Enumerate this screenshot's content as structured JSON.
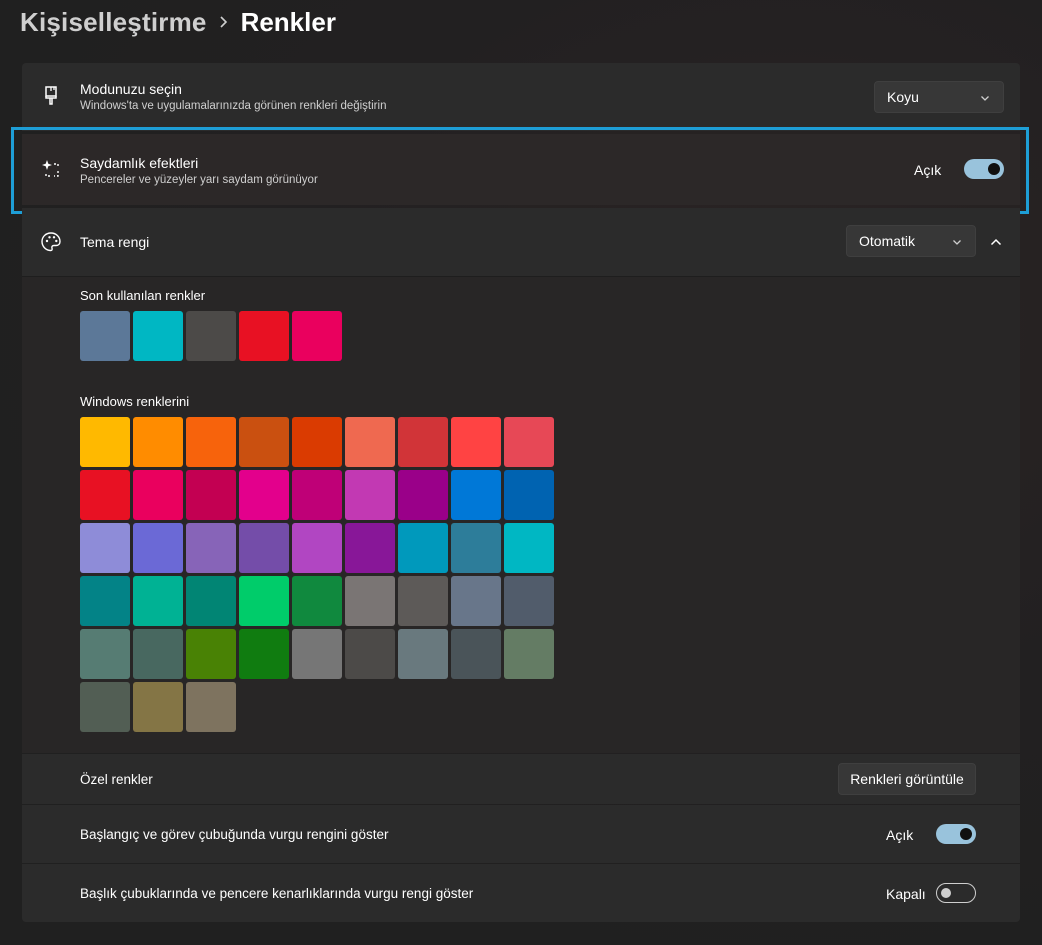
{
  "breadcrumb": {
    "parent": "Kişiselleştirme",
    "current": "Renkler"
  },
  "mode": {
    "title": "Modunuzu seçin",
    "subtitle": "Windows'ta ve uygulamalarınızda görünen renkleri değiştirin",
    "selected": "Koyu",
    "icon": "paint-brush-icon"
  },
  "transparency": {
    "title": "Saydamlık efektleri",
    "subtitle": "Pencereler ve yüzeyler yarı saydam görünüyor",
    "state_label": "Açık",
    "on": true,
    "icon": "sparkle-selection-icon"
  },
  "accent": {
    "title": "Tema rengi",
    "selected": "Otomatik",
    "icon": "palette-icon",
    "expanded": true
  },
  "recent_colors": {
    "label": "Son kullanılan renkler",
    "colors": [
      "#5c7898",
      "#00b7c3",
      "#4c4a48",
      "#e81123",
      "#ea005e"
    ]
  },
  "windows_colors": {
    "label": "Windows renklerini",
    "colors": [
      "#ffb900",
      "#ff8c00",
      "#f7630c",
      "#ca5010",
      "#da3b01",
      "#ef6950",
      "#d13438",
      "#ff4343",
      "#e74856",
      "#e81123",
      "#ea005e",
      "#c30052",
      "#e3008c",
      "#bf0077",
      "#c239b3",
      "#9a0089",
      "#0078d7",
      "#0063b1",
      "#8e8cd8",
      "#6b69d6",
      "#8764b8",
      "#744da9",
      "#b146c2",
      "#881798",
      "#0099bc",
      "#2d7d9a",
      "#00b7c3",
      "#038387",
      "#00b294",
      "#018574",
      "#00cc6a",
      "#10893e",
      "#7a7574",
      "#5d5a58",
      "#68768a",
      "#515c6b",
      "#567c73",
      "#486860",
      "#498205",
      "#107c10",
      "#767676",
      "#4c4a48",
      "#69797e",
      "#4a5459",
      "#647c64",
      "#525e54",
      "#847545",
      "#7e735f"
    ]
  },
  "custom_colors": {
    "label": "Özel renkler",
    "button": "Renkleri görüntüle"
  },
  "start_taskbar": {
    "title": "Başlangıç ve görev çubuğunda vurgu rengini göster",
    "state_label": "Açık",
    "on": true
  },
  "title_bars": {
    "title": "Başlık çubuklarında ve pencere kenarlıklarında vurgu rengi göster",
    "state_label": "Kapalı",
    "on": false
  },
  "colors": {
    "accent": "#99c3dc",
    "focus": "#1e9ed6",
    "card": "#2b2b2b",
    "background": "#202020"
  }
}
